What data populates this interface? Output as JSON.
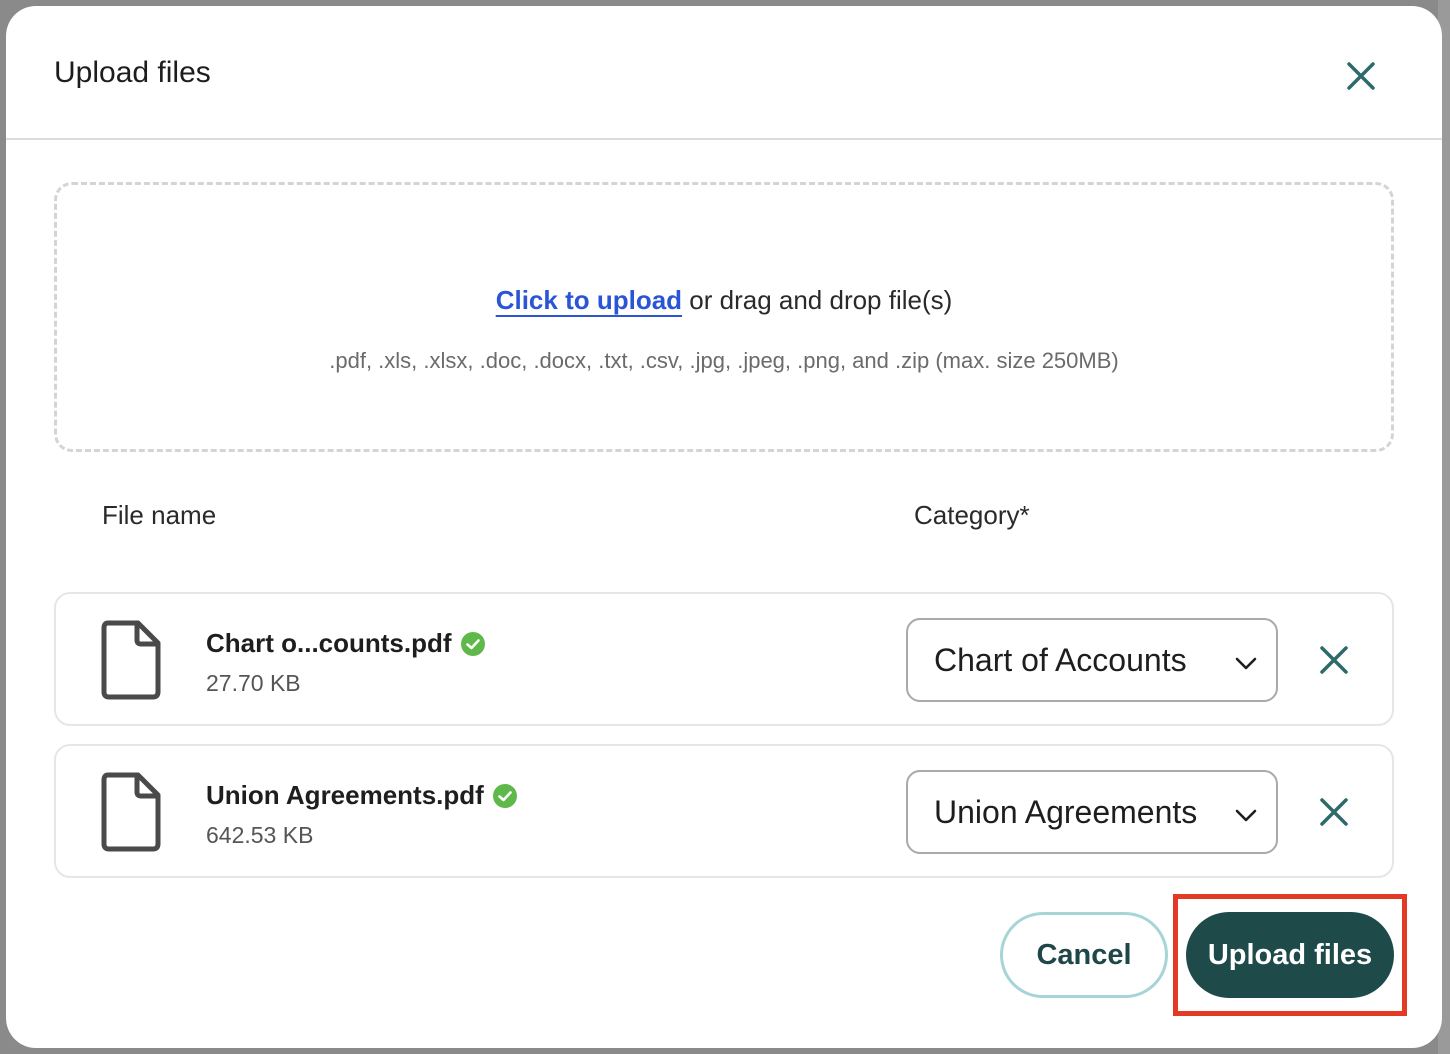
{
  "modal": {
    "title": "Upload files",
    "close_icon": "close-icon"
  },
  "dropzone": {
    "link_text": "Click to upload",
    "rest_text": " or drag and drop file(s)",
    "hint": ".pdf, .xls, .xlsx, .doc, .docx, .txt, .csv, .jpg, .jpeg, .png, and .zip (max. size 250MB)"
  },
  "table": {
    "col_file_name": "File name",
    "col_category": "Category*"
  },
  "files": [
    {
      "name": "Chart o...counts.pdf",
      "size": "27.70 KB",
      "category": "Chart of Accounts",
      "status_icon": "check-circle-icon"
    },
    {
      "name": "Union Agreements.pdf",
      "size": "642.53 KB",
      "category": "Union Agreements",
      "status_icon": "check-circle-icon"
    }
  ],
  "footer": {
    "cancel_label": "Cancel",
    "upload_label": "Upload files"
  },
  "colors": {
    "accent_dark": "#1f4a4a",
    "link_blue": "#2a55d6",
    "success_green": "#5fb84a",
    "highlight_red": "#e23a24"
  }
}
